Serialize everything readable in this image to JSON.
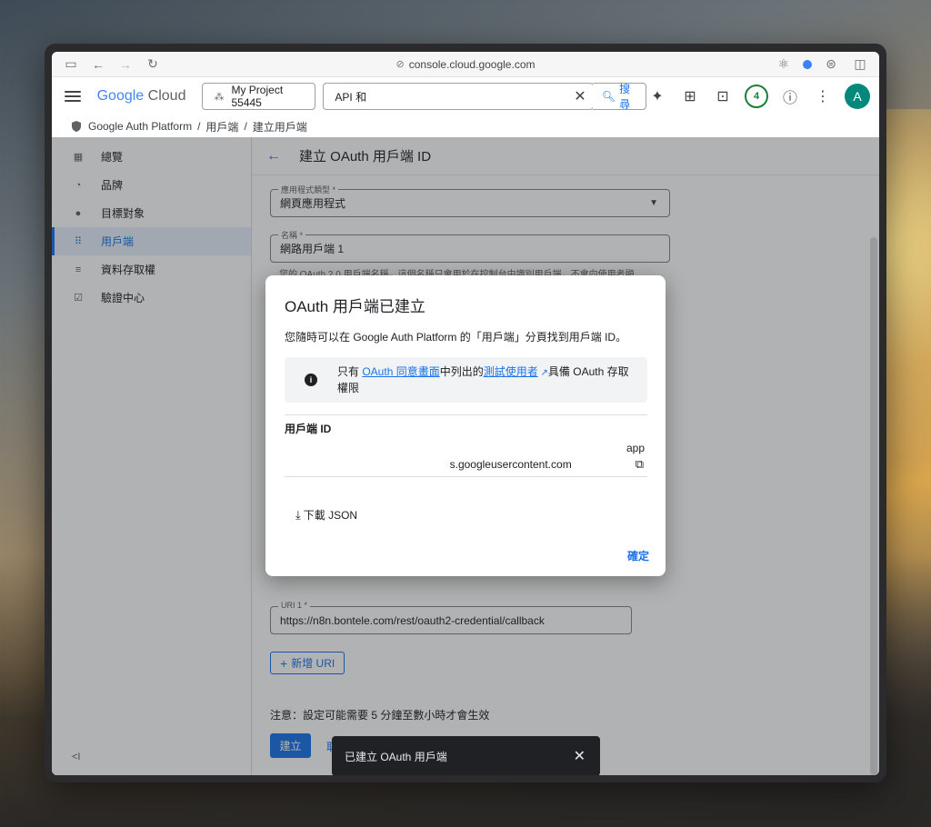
{
  "browser": {
    "url": "console.cloud.google.com"
  },
  "header": {
    "logo_google": "Google",
    "logo_cloud": "Cloud",
    "project": "My Project 55445",
    "search_value": "API 和",
    "search_button": "搜尋",
    "notification_count": "4",
    "avatar_letter": "A"
  },
  "breadcrumb": {
    "items": [
      "Google Auth Platform",
      "用戶端",
      "建立用戶端"
    ],
    "separator": "/"
  },
  "sidebar": {
    "items": [
      {
        "label": "總覽",
        "icon": "dashboard-icon"
      },
      {
        "label": "品牌",
        "icon": "palette-icon"
      },
      {
        "label": "目標對象",
        "icon": "person-icon"
      },
      {
        "label": "用戶端",
        "icon": "grid-icon"
      },
      {
        "label": "資料存取權",
        "icon": "data-access-icon"
      },
      {
        "label": "驗證中心",
        "icon": "verification-icon"
      }
    ],
    "collapse": "<I"
  },
  "main": {
    "title": "建立 OAuth 用戶端 ID",
    "app_type_label": "應用程式類型 *",
    "app_type_value": "網頁應用程式",
    "name_label": "名稱 *",
    "name_value": "網路用戶端 1",
    "name_hint": "您的 OAuth 2.0 用戶端名稱。這個名稱只會用於在控制台中識別用戶端，不會向使用者顯",
    "uri_label": "URI 1 *",
    "uri_value": "https://n8n.bontele.com/rest/oauth2-credential/callback",
    "add_uri": "新增 URI",
    "note": "注意：設定可能需要 5 分鐘至數小時才會生效",
    "create": "建立",
    "cancel_peek": "取"
  },
  "modal": {
    "title": "OAuth 用戶端已建立",
    "desc": "您隨時可以在 Google Auth Platform 的「用戶端」分頁找到用戶端 ID。",
    "info_pre": "只有 ",
    "info_link1": "OAuth 同意畫面",
    "info_mid": "中列出的",
    "info_link2": "測試使用者",
    "info_post": "具備 OAuth 存取權限",
    "client_id_label": "用戶端 ID",
    "client_id_line1": "app",
    "client_id_line2": "s.googleusercontent.com",
    "download": "下載 JSON",
    "confirm": "確定"
  },
  "snackbar": {
    "text": "已建立 OAuth 用戶端"
  }
}
